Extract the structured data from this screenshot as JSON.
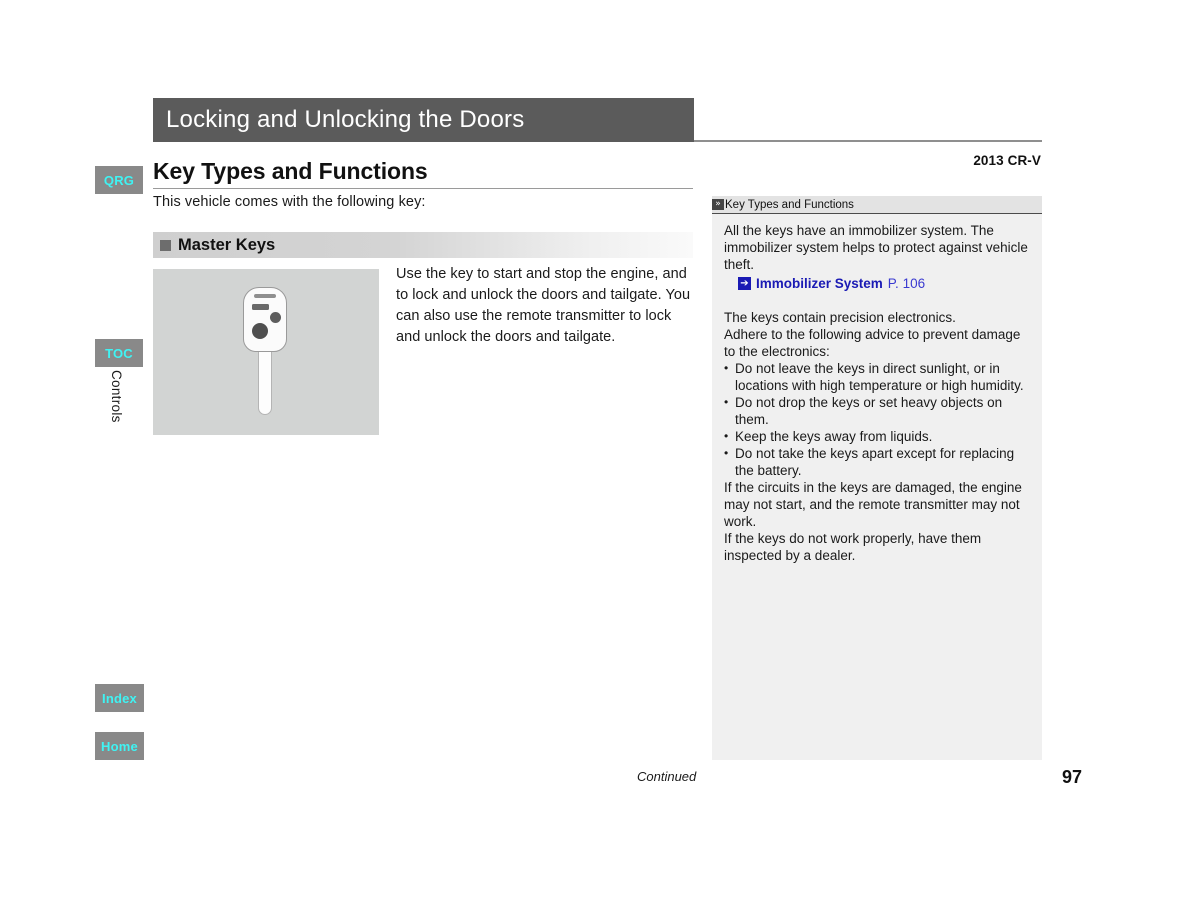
{
  "header": {
    "section_title": "Locking and Unlocking the Doors",
    "model": "2013 CR-V"
  },
  "nav": {
    "qrg": "QRG",
    "toc": "TOC",
    "index": "Index",
    "home": "Home",
    "section_label": "Controls"
  },
  "main": {
    "heading": "Key Types and Functions",
    "intro": "This vehicle comes with the following key:",
    "subheading": "Master Keys",
    "figure_caption": "master-key-illustration",
    "body": "Use the key to start and stop the engine, and to lock and unlock the doors and tailgate. You can also use the remote transmitter to lock and unlock the doors and tailgate."
  },
  "side_panel": {
    "head": "Key Types and Functions",
    "chevron": "»",
    "para1": "All the keys have an immobilizer system. The immobilizer system helps to protect against vehicle theft.",
    "xref": {
      "icon": "➔",
      "title": "Immobilizer System",
      "page": "P. 106"
    },
    "para2": "The keys contain precision electronics.",
    "para3": "Adhere to the following advice to prevent damage to the electronics:",
    "bullets": [
      "Do not leave the keys in direct sunlight, or in locations with high temperature or high humidity.",
      "Do not drop the keys or set heavy objects on them.",
      "Keep the keys away from liquids.",
      "Do not take the keys apart except for replacing the battery."
    ],
    "para4": "If the circuits in the keys are damaged, the engine may not start, and the remote transmitter may not work.",
    "para5": "If the keys do not work properly, have them inspected by a dealer."
  },
  "footer": {
    "continued": "Continued",
    "page_number": "97"
  },
  "colors": {
    "title_bar": "#5b5b5b",
    "tab_bg": "#898989",
    "tab_text": "#3ff3f3",
    "panel_bg": "#f0f0f0",
    "link": "#1a1ab4"
  }
}
